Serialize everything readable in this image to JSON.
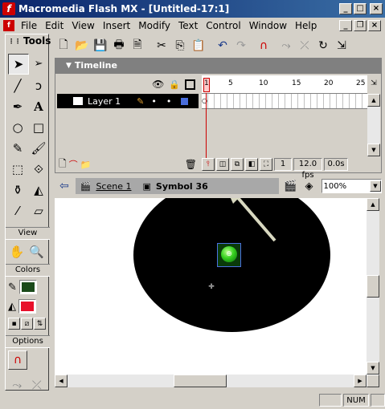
{
  "window": {
    "title": "Macromedia Flash MX - [Untitled-17:1]",
    "minimize": "_",
    "maximize": "□",
    "close": "×",
    "doc_minimize": "_",
    "doc_restore": "❐",
    "doc_close": "×"
  },
  "menubar": [
    {
      "label": "File"
    },
    {
      "label": "Edit"
    },
    {
      "label": "View"
    },
    {
      "label": "Insert"
    },
    {
      "label": "Modify"
    },
    {
      "label": "Text"
    },
    {
      "label": "Control"
    },
    {
      "label": "Window"
    },
    {
      "label": "Help"
    }
  ],
  "tools_panel": {
    "title": "Tools",
    "view_label": "View",
    "colors_label": "Colors",
    "options_label": "Options",
    "stroke_color": "#1a4a1a",
    "fill_color": "#e8102a"
  },
  "timeline": {
    "title": "Timeline",
    "frame_numbers": [
      "1",
      "5",
      "10",
      "15",
      "20",
      "25"
    ],
    "layer_name": "Layer 1",
    "current_frame": "1",
    "frame_rate": "12.0 fps",
    "elapsed_time": "0.0s"
  },
  "edit_bar": {
    "scene": "Scene 1",
    "symbol": "Symbol 36",
    "zoom": "100%"
  },
  "status_bar": {
    "num_lock": "NUM"
  }
}
